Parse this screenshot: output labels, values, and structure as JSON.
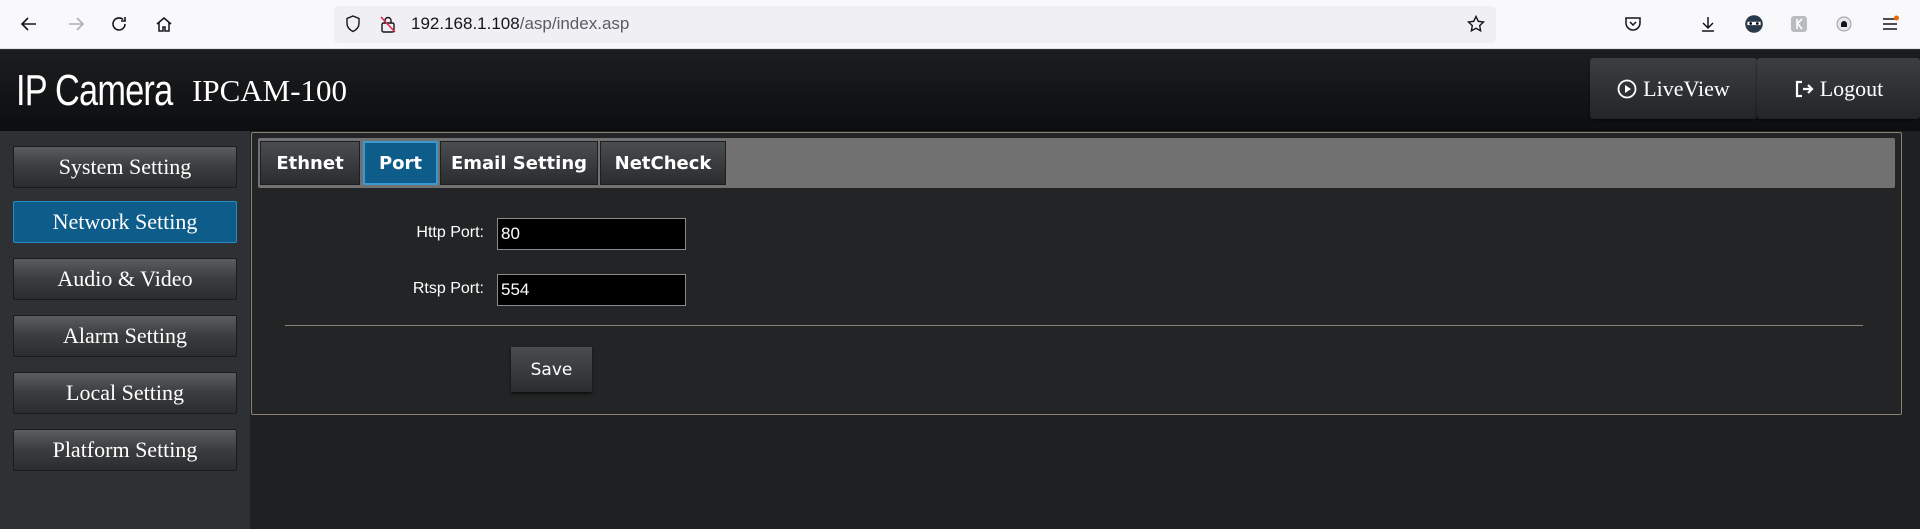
{
  "browser": {
    "url_host": "192.168.1.108",
    "url_path": "/asp/index.asp"
  },
  "header": {
    "logo": "IP Camera",
    "model": "IPCAM-100",
    "liveview_label": "LiveView",
    "logout_label": "Logout"
  },
  "sidebar": {
    "items": [
      {
        "label": "System Setting"
      },
      {
        "label": "Network Setting"
      },
      {
        "label": "Audio & Video"
      },
      {
        "label": "Alarm Setting"
      },
      {
        "label": "Local Setting"
      },
      {
        "label": "Platform Setting"
      }
    ],
    "active": "Network Setting"
  },
  "tabs": [
    {
      "label": "Ethnet"
    },
    {
      "label": "Port"
    },
    {
      "label": "Email Setting"
    },
    {
      "label": "NetCheck"
    }
  ],
  "active_tab": "Port",
  "form": {
    "http_label": "Http Port:",
    "http_value": "80",
    "rtsp_label": "Rtsp Port:",
    "rtsp_value": "554",
    "save_label": "Save"
  },
  "colors": {
    "accent": "#0d5c8a",
    "header_bg": "#0d0e0f",
    "panel_border": "#8a8372"
  }
}
